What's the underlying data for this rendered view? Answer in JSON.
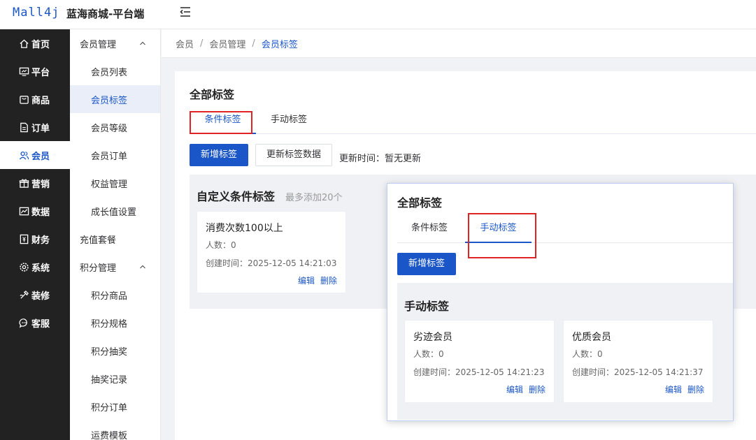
{
  "header": {
    "logo": "Mall4j",
    "app_title": "蓝海商城-平台端"
  },
  "sidebar": {
    "items": [
      {
        "label": "首页",
        "icon": "home-icon"
      },
      {
        "label": "平台",
        "icon": "monitor-icon"
      },
      {
        "label": "商品",
        "icon": "bag-icon"
      },
      {
        "label": "订单",
        "icon": "document-icon"
      },
      {
        "label": "会员",
        "icon": "users-icon",
        "active": true
      },
      {
        "label": "营销",
        "icon": "gift-icon"
      },
      {
        "label": "数据",
        "icon": "chart-icon"
      },
      {
        "label": "财务",
        "icon": "finance-icon"
      },
      {
        "label": "系统",
        "icon": "gear-icon"
      },
      {
        "label": "装修",
        "icon": "palette-icon"
      },
      {
        "label": "客服",
        "icon": "chat-icon"
      }
    ]
  },
  "subnav": {
    "group1": "会员管理",
    "group1_items": [
      "会员列表",
      "会员标签",
      "会员等级",
      "会员订单",
      "权益管理",
      "成长值设置"
    ],
    "plain": "充值套餐",
    "group2": "积分管理",
    "group2_items": [
      "积分商品",
      "积分规格",
      "积分抽奖",
      "抽奖记录",
      "积分订单",
      "运费模板"
    ]
  },
  "breadcrumb": {
    "items": [
      "会员",
      "会员管理",
      "会员标签"
    ],
    "sep": "/"
  },
  "main": {
    "title": "全部标签",
    "tabs": [
      "条件标签",
      "手动标签"
    ],
    "add_button": "新增标签",
    "update_button": "更新标签数据",
    "update_text": "更新时间：暂无更新",
    "section_title": "自定义条件标签",
    "section_hint": "最多添加20个",
    "card": {
      "title": "消费次数100以上",
      "count": "人数：0",
      "time": "创建时间：2025-12-05 14:21:03",
      "edit": "编辑",
      "delete": "删除"
    }
  },
  "overlay": {
    "title": "全部标签",
    "tabs": [
      "条件标签",
      "手动标签"
    ],
    "add_button": "新增标签",
    "section_title": "手动标签",
    "cards": [
      {
        "title": "劣迹会员",
        "count": "人数：0",
        "time": "创建时间：2025-12-05 14:21:23",
        "edit": "编辑",
        "delete": "删除"
      },
      {
        "title": "优质会员",
        "count": "人数：0",
        "time": "创建时间：2025-12-05 14:21:37",
        "edit": "编辑",
        "delete": "删除"
      }
    ]
  },
  "colors": {
    "accent": "#1a56c7",
    "sidebar_bg": "#222222",
    "highlight": "#e02424"
  }
}
